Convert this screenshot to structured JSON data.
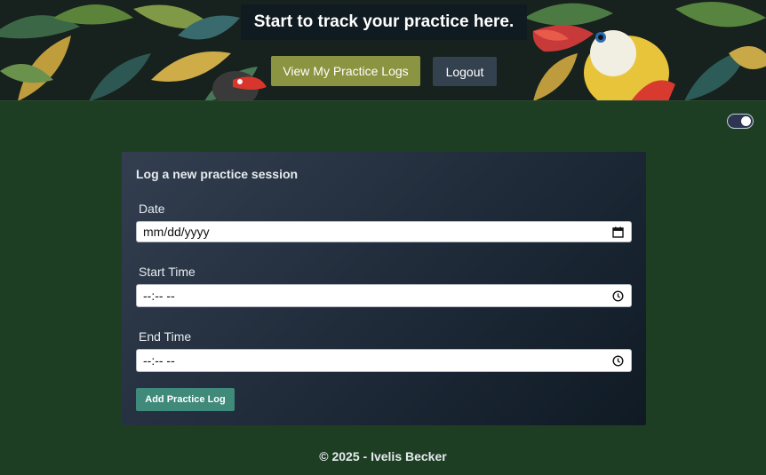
{
  "hero": {
    "title": "Start to track your practice here.",
    "view_logs_label": "View My Practice Logs",
    "logout_label": "Logout"
  },
  "form": {
    "title": "Log a new practice session",
    "date_label": "Date",
    "date_value": "mm/dd/yyyy",
    "start_label": "Start Time",
    "start_value": "--:-- --",
    "end_label": "End Time",
    "end_value": "--:-- --",
    "submit_label": "Add Practice Log"
  },
  "footer": {
    "copyright": "© 2025 - Ivelis Becker"
  },
  "theme_toggle": {
    "state": "on"
  },
  "colors": {
    "page_background": "#1d3e22",
    "primary_button": "#8b9440",
    "secondary_button": "#34414f",
    "accent_button": "#3f8a7a"
  },
  "icons": {
    "date_field": "calendar-icon",
    "time_field": "clock-icon"
  }
}
